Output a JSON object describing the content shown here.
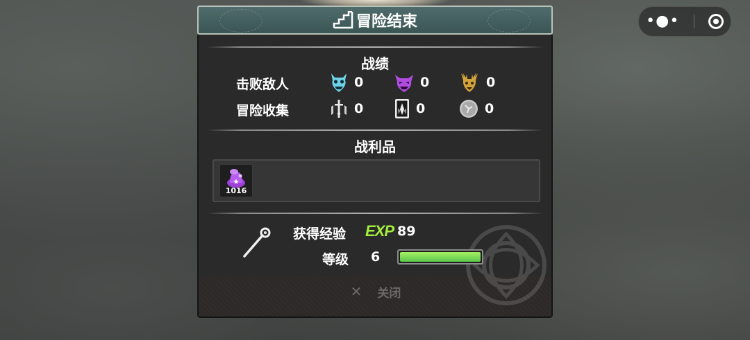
{
  "window": {
    "title": "冒险结束"
  },
  "system": {
    "more_icon": "more-dots-icon",
    "close_icon": "target-icon"
  },
  "record": {
    "title": "战绩",
    "rows": [
      {
        "label": "击败敌人",
        "items": [
          {
            "icon": "blue-oni-mask-icon",
            "value": "0"
          },
          {
            "icon": "purple-demon-mask-icon",
            "value": "0"
          },
          {
            "icon": "gold-deer-boss-icon",
            "value": "0"
          }
        ]
      },
      {
        "label": "冒险收集",
        "items": [
          {
            "icon": "sword-totem-icon",
            "value": "0"
          },
          {
            "icon": "crystal-card-icon",
            "value": "0"
          },
          {
            "icon": "silver-coin-icon",
            "value": "0"
          }
        ]
      }
    ]
  },
  "loot": {
    "title": "战利品",
    "items": [
      {
        "icon": "purple-fungus-icon",
        "count": "1016"
      }
    ]
  },
  "result": {
    "weapon_icon": "staff-weapon-icon",
    "exp_label": "获得经验",
    "exp_tag": "EXP",
    "exp_value": "89",
    "level_label": "等级",
    "level_value": "6",
    "level_progress": 1.0
  },
  "footer": {
    "close_label": "关闭"
  },
  "colors": {
    "accent_green": "#a4ef3c",
    "title_bar": "#46605f",
    "panel": "#2a2a2a"
  }
}
